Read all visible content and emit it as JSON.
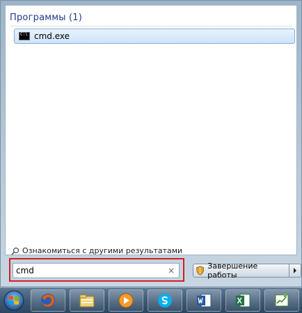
{
  "results": {
    "group_header": "Программы (1)",
    "items": [
      {
        "label": "cmd.exe",
        "icon": "cmd-icon"
      }
    ],
    "more_results_label": "Ознакомиться с другими результатами"
  },
  "search": {
    "value": "cmd"
  },
  "shutdown": {
    "label": "Завершение работы"
  },
  "taskbar": {
    "items": [
      "start-orb",
      "firefox-icon",
      "file-explorer-icon",
      "media-player-icon",
      "skype-icon",
      "word-icon",
      "excel-icon",
      "whiteboard-icon"
    ]
  },
  "colors": {
    "highlight_border": "#d21f1f",
    "selection": "#cfe3fb"
  }
}
